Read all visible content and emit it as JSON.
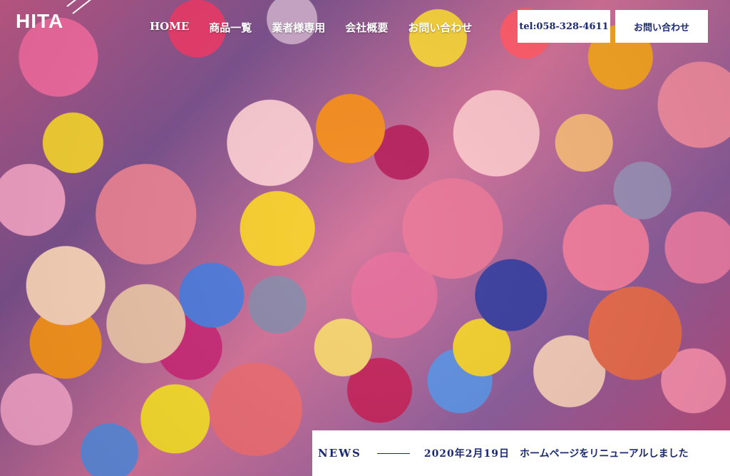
{
  "header": {
    "logo": "HITA",
    "nav": [
      {
        "label": "HOME"
      },
      {
        "label": "商品一覧"
      },
      {
        "label": "業者様専用"
      },
      {
        "label": "会社概要"
      },
      {
        "label": "お問い合わせ"
      }
    ],
    "tel_button": "tel:058-328-4611",
    "contact_button": "お問い合わせ"
  },
  "news": {
    "label": "NEWS",
    "date": "2020年2月19日",
    "text": "ホームページをリニューアルしました"
  }
}
